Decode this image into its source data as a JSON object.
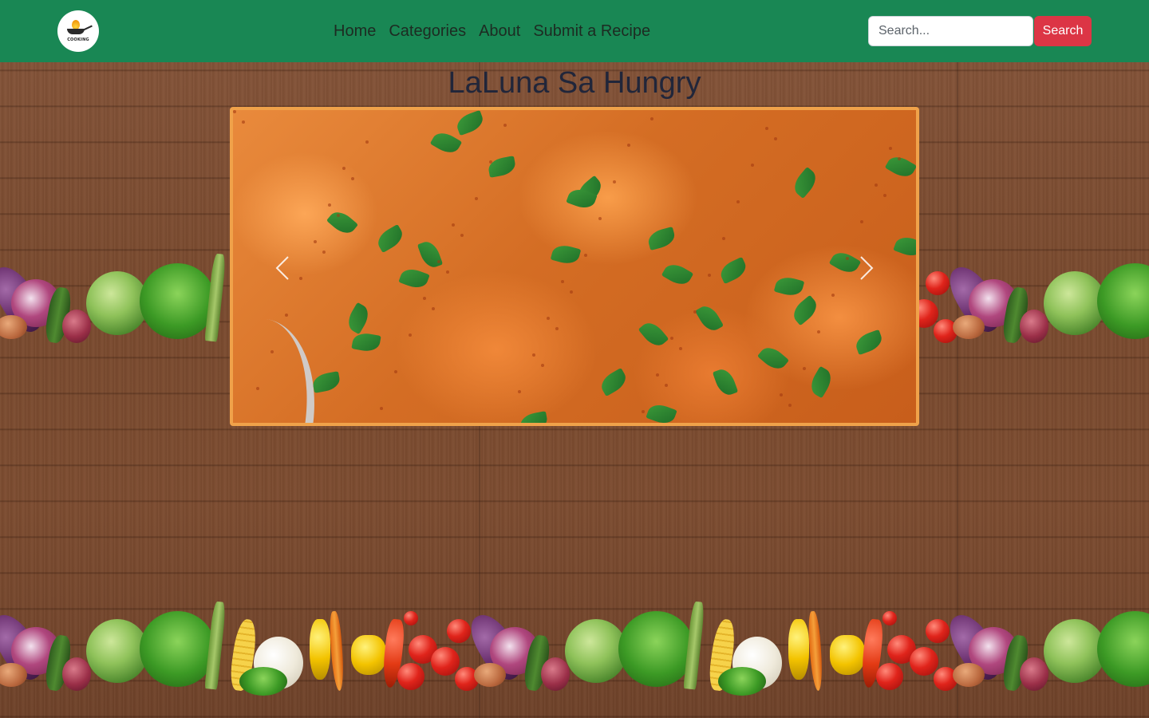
{
  "nav": {
    "logo_text": "COOKING",
    "links": [
      "Home",
      "Categories",
      "About",
      "Submit a Recipe"
    ],
    "search_placeholder": "Search...",
    "search_button": "Search",
    "brand_color": "#198754",
    "search_button_color": "#dc3545"
  },
  "main": {
    "title": "LaLuna Sa Hungry",
    "carousel": {
      "slide_description": "creamy orange curry with chopped cilantro",
      "prev_icon": "chevron-left-icon",
      "next_icon": "chevron-right-icon",
      "border_color": "#f0a24a"
    }
  },
  "background": {
    "texture": "wood planks",
    "border_decoration": "vegetables"
  }
}
